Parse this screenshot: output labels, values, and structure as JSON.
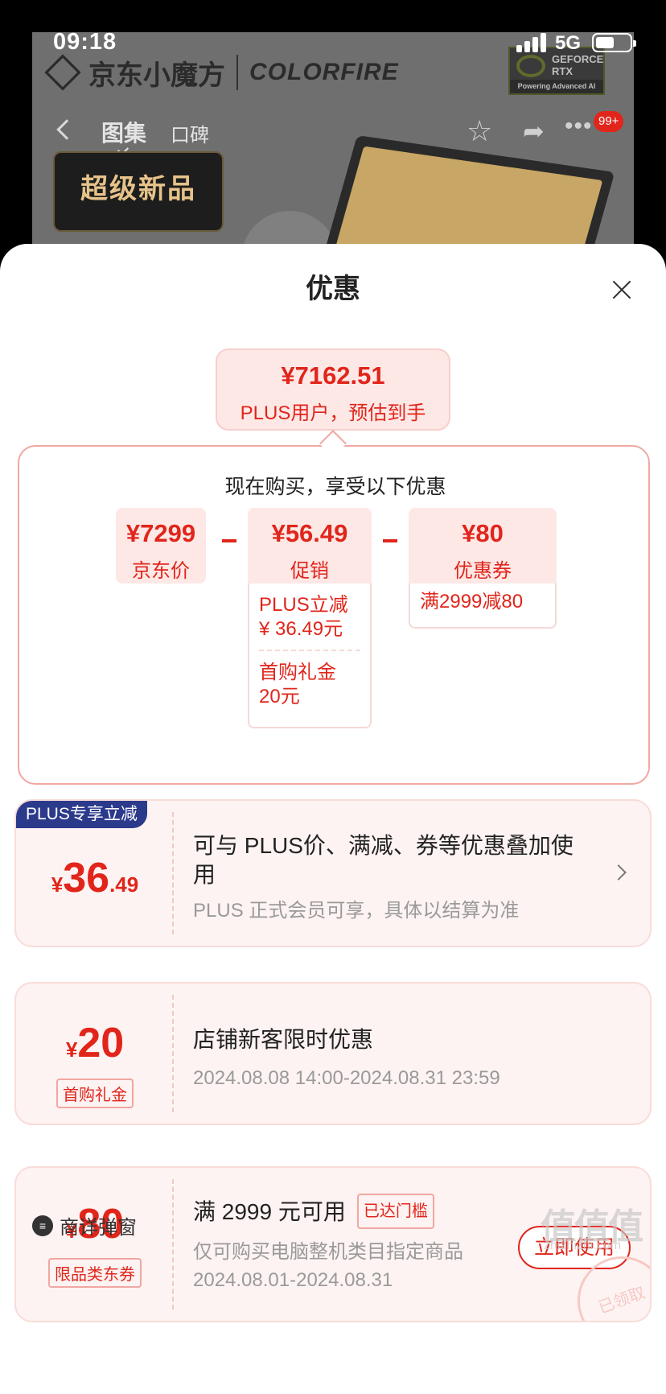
{
  "status_bar": {
    "time": "09:18",
    "network": "5G"
  },
  "background": {
    "brand_name": "京东小魔方",
    "brand_partner": "COLORFIRE",
    "gpu_badge": {
      "line1": "GEFORCE",
      "line2": "RTX",
      "footer": "Powering Advanced AI"
    },
    "nav_tabs": [
      "图集",
      "口碑"
    ],
    "message_count": "99+",
    "promo_label": "超级新品"
  },
  "sheet": {
    "title": "优惠",
    "estimate": {
      "price": "¥7162.51",
      "label": "PLUS用户，预估到手"
    },
    "breakdown": {
      "title": "现在购买，享受以下优惠",
      "chips": [
        {
          "value": "¥7299",
          "label": "京东价"
        },
        {
          "value": "¥56.49",
          "label": "促销"
        },
        {
          "value": "¥80",
          "label": "优惠券"
        }
      ],
      "operators": [
        "-",
        "-"
      ],
      "promo_details": [
        "PLUS立减\n¥ 36.49元",
        "首购礼金\n20元"
      ],
      "coupon_details": [
        "满2999减80"
      ]
    },
    "cards": [
      {
        "tag": "PLUS专享立减",
        "currency": "¥",
        "amount_int": "36",
        "amount_dec": ".49",
        "title": "可与 PLUS价、满减、券等优惠叠加使用",
        "subtitle": "PLUS 正式会员可享，具体以结算为准"
      },
      {
        "currency": "¥",
        "amount_int": "20",
        "badge": "首购礼金",
        "title": "店铺新客限时优惠",
        "subtitle": "2024.08.08 14:00-2024.08.31 23:59"
      },
      {
        "currency": "¥",
        "amount_int": "80",
        "badge": "限品类东券",
        "title": "满 2999 元可用",
        "status_tag": "已达门槛",
        "desc": "仅可购买电脑整机类目指定商品",
        "subtitle": "2024.08.01-2024.08.31",
        "button": "立即使用",
        "stamp": "已领取"
      }
    ],
    "footer_link": "商详弹窗"
  },
  "watermark": {
    "text": "值值值",
    "url": "zhizhizhi.com"
  },
  "colors": {
    "accent": "#e1251b",
    "plus_tag": "#2c3a8c",
    "card_bg": "#fdf3f2"
  }
}
